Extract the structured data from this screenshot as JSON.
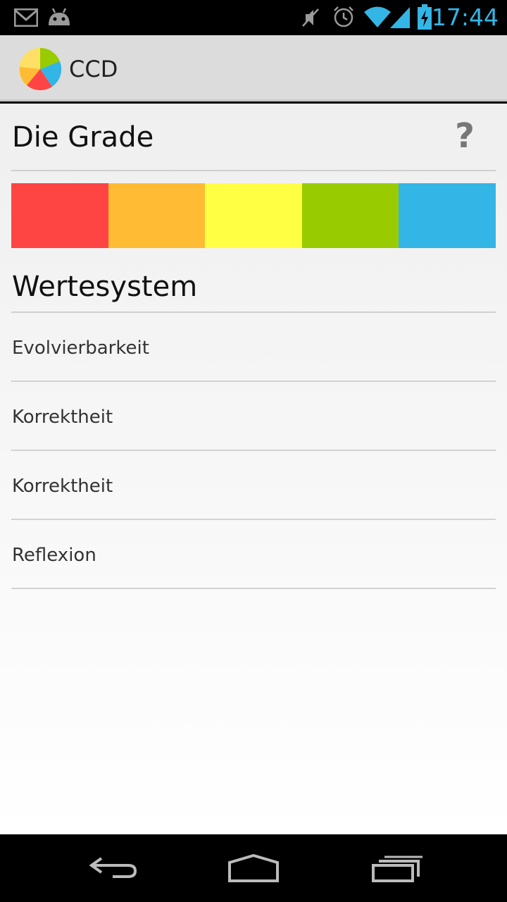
{
  "status_bar": {
    "time": "17:44",
    "icons": [
      "gmail-icon",
      "android-icon",
      "mute-icon",
      "alarm-icon",
      "wifi-icon",
      "signal-icon",
      "battery-charging-icon"
    ]
  },
  "action_bar": {
    "title": "CCD",
    "logo": "ccd-app-logo"
  },
  "grade": {
    "title": "Die Grade",
    "help_label": "?",
    "colors": [
      "#ff4444",
      "#ffbb33",
      "#ffff44",
      "#99cc00",
      "#33b5e5"
    ]
  },
  "section": {
    "title": "Wertesystem"
  },
  "values": [
    {
      "label": "Evolvierbarkeit"
    },
    {
      "label": "Korrektheit"
    },
    {
      "label": "Korrektheit"
    },
    {
      "label": "Reflexion"
    }
  ],
  "nav_bar": {
    "buttons": [
      "back-icon",
      "home-icon",
      "recent-apps-icon"
    ]
  }
}
